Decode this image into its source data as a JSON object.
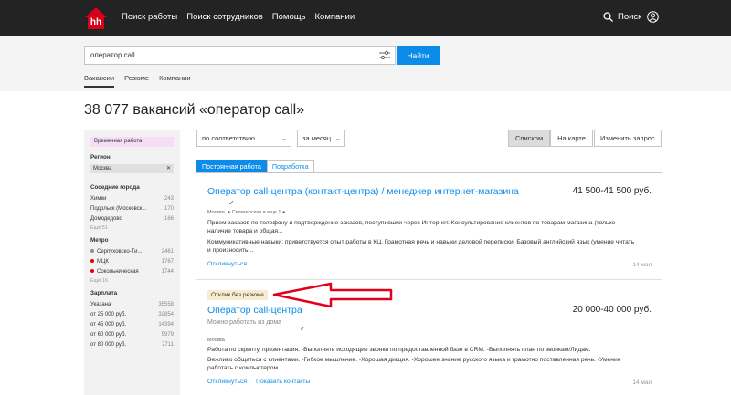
{
  "header": {
    "logo": "hh",
    "nav": [
      "Поиск работы",
      "Поиск сотрудников",
      "Помощь",
      "Компании"
    ],
    "search_label": "Поиск"
  },
  "search": {
    "value": "оператор call",
    "button": "Найти",
    "tabs": [
      "Вакансии",
      "Резюме",
      "Компании"
    ]
  },
  "page_title": "38 077 вакансий «оператор call»",
  "sidebar": {
    "tag": "Временная работа",
    "region_title": "Регион",
    "region_value": "Москва",
    "neighbors_title": "Соседние города",
    "neighbors": [
      {
        "name": "Химки",
        "count": "243"
      },
      {
        "name": "Подольск (Московск...",
        "count": "170"
      },
      {
        "name": "Домодедово",
        "count": "166"
      }
    ],
    "neighbors_more": "Ещё 51",
    "metro_title": "Метро",
    "metro": [
      {
        "name": "Серпуховско-Ти...",
        "count": "2461",
        "color": "#8f8f8f"
      },
      {
        "name": "МЦК",
        "count": "1767",
        "color": "#e4000f"
      },
      {
        "name": "Сокольническая",
        "count": "1744",
        "color": "#e4000f"
      }
    ],
    "metro_more": "Ещё 16",
    "salary_title": "Зарплата",
    "salary": [
      {
        "name": "Указана",
        "count": "35558"
      },
      {
        "name": "от 25 000 руб.",
        "count": "32854"
      },
      {
        "name": "от 45 000 руб.",
        "count": "14394"
      },
      {
        "name": "от 60 000 руб.",
        "count": "5979"
      },
      {
        "name": "от 80 000 руб.",
        "count": "2711"
      }
    ]
  },
  "controls": {
    "sort": "по соответствию",
    "period": "за месяц",
    "view_list": "Списком",
    "view_map": "На карте",
    "change": "Изменить запрос"
  },
  "job_tabs": [
    "Постоянная работа",
    "Подработка"
  ],
  "vacancies": [
    {
      "title": "Оператор call-центра (контакт-центра) / менеджер интернет-магазина",
      "salary": "41 500-41 500 руб.",
      "meta": "Москва, ● Селигерская и еще 1 ●",
      "desc1": "Прием заказов по телефону и подтверждение заказов, поступивших через Интернет. Консультирование клиентов по товарам магазина (только наличие товара и общая...",
      "desc2": "Коммуникативные навыки: приветствуется опыт работы в КЦ. Грамотная речь и навыки деловой переписки. Базовый английский язык (умение читать и произносить...",
      "action": "Откликнуться",
      "date": "14 мая"
    },
    {
      "badge": "Отклик без резюме",
      "title": "Оператор call-центра",
      "salary": "20 000-40 000 руб.",
      "subtitle": "Можно работать из дома",
      "meta": "Москва",
      "desc1": "Работа по скрипту, презентация. -Выполнять исходящие звонки по предоставленной базе в CRM. -Выполнять план по звонкам/Лидам.",
      "desc2": "Вежливо общаться с клиентами. -Гибкое мышление. -Хорошая дикция. -Хорошее знание русского языка и грамотно поставленная речь. -Умение работать с компьютером...",
      "action": "Откликнуться",
      "action2": "Показать контакты",
      "date": "14 мая"
    }
  ],
  "colors": {
    "accent": "#0c8ce9",
    "header": "#232323",
    "logo": "#d6001c",
    "arrow": "#e3001b"
  }
}
